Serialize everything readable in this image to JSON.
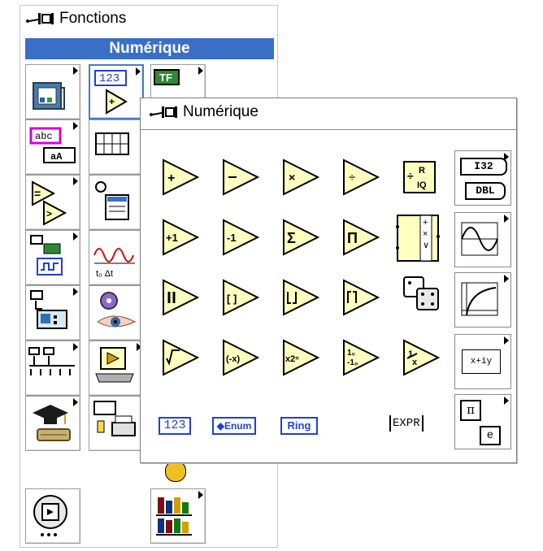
{
  "fonctions": {
    "title": "Fonctions",
    "category": "Numérique"
  },
  "numerique": {
    "title": "Numérique",
    "pills": {
      "num": "123",
      "enum": "◆Enum",
      "ring": "Ring"
    },
    "expr": "EXPR",
    "conv": {
      "i32": "I32",
      "dbl": "DBL"
    },
    "complex_label": "x+iy",
    "const_e": "e",
    "tf_label": "TF",
    "abc_label": "abc",
    "num_tile_label": "123"
  }
}
